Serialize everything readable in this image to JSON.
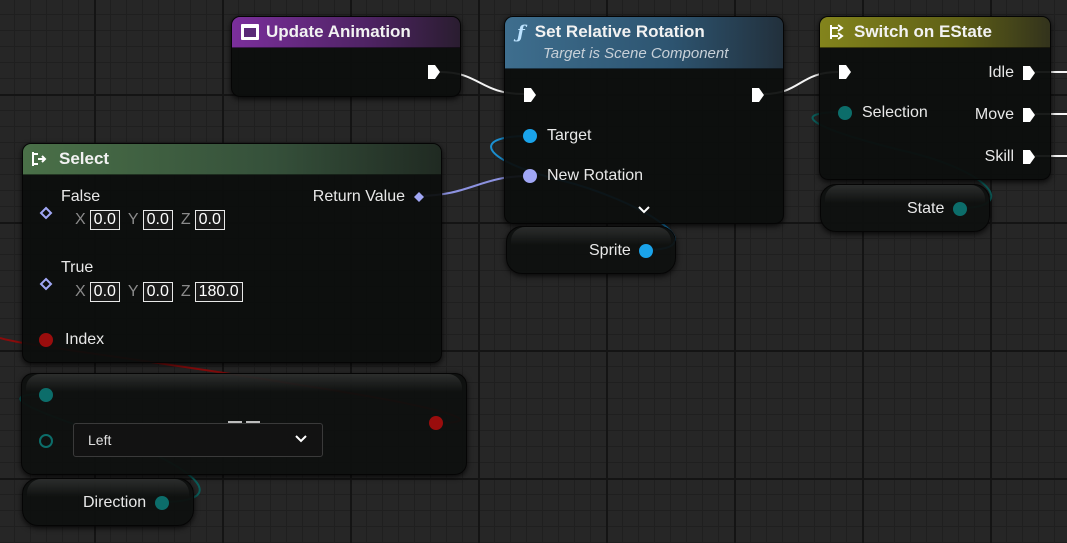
{
  "colors": {
    "exec": "#ffffff",
    "object": "#1aa3ea",
    "rotator": "#a1a7f5",
    "byte": "#0c6d6a",
    "bool": "#9a0d0d",
    "purple_header": "#6a2a86",
    "blue_header": "#2d5470",
    "green_header": "#3b5c34",
    "olive_header": "#73741a"
  },
  "nodes": {
    "update_animation": {
      "title": "Update Animation",
      "icon": "event-icon"
    },
    "set_relative_rotation": {
      "title": "Set Relative Rotation",
      "subtitle": "Target is Scene Component",
      "icon": "function-icon",
      "pins": {
        "target": "Target",
        "new_rotation": "New Rotation"
      }
    },
    "switch_on_estate": {
      "title": "Switch on EState",
      "icon": "switch-icon",
      "pins": {
        "selection": "Selection",
        "idle": "Idle",
        "move": "Move",
        "skill": "Skill"
      }
    },
    "select": {
      "title": "Select",
      "icon": "select-icon",
      "pins": {
        "false": "False",
        "true": "True",
        "index": "Index",
        "return_value": "Return Value"
      },
      "false_vec": {
        "x": "0.0",
        "y": "0.0",
        "z": "0.0"
      },
      "true_vec": {
        "x": "0.0",
        "y": "0.0",
        "z": "180.0"
      },
      "axes": {
        "x": "X",
        "y": "Y",
        "z": "Z"
      }
    },
    "equal_enum": {
      "dropdown_value": "Left",
      "operator_icon": "equals-icon"
    }
  },
  "variables": {
    "sprite": "Sprite",
    "state": "State",
    "direction": "Direction"
  }
}
